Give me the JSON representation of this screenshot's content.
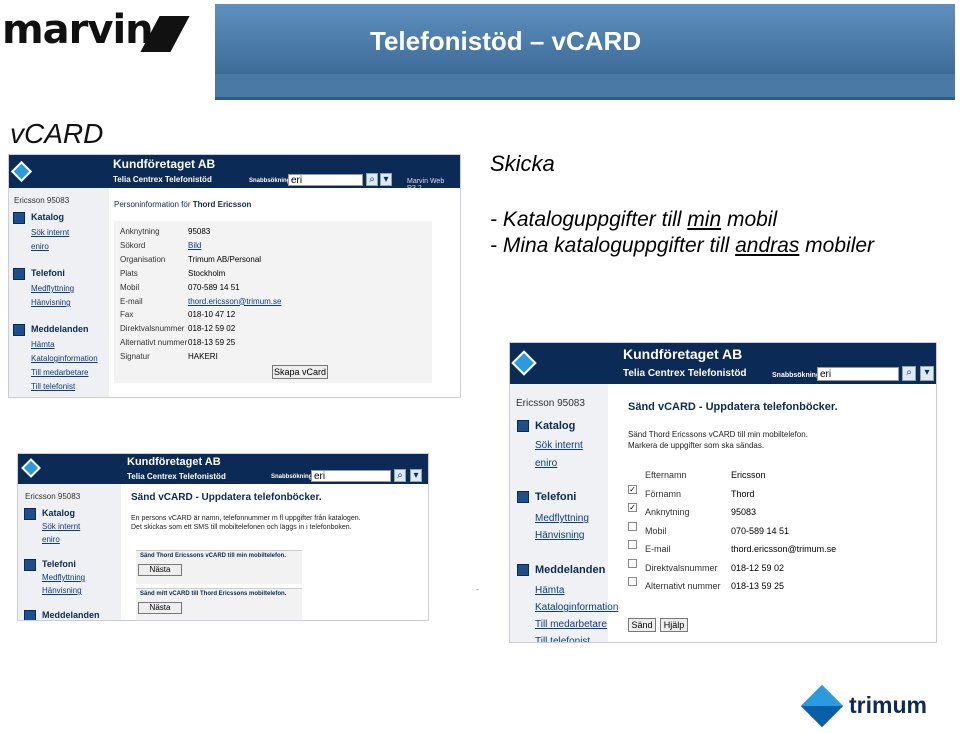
{
  "slide": {
    "logo_text": "marvin",
    "title": "Telefonistöd – vCARD",
    "heading": "vCARD",
    "skicka": "Skicka",
    "bullet1": {
      "pre": "- Kataloguppgifter till ",
      "u": "min",
      "post": " mobil"
    },
    "bullet2": {
      "pre": "- Mina kataloguppgifter till ",
      "u": "andras",
      "post": " mobiler"
    },
    "footer_logo": "trimum"
  },
  "app": {
    "company": "Kundföretaget AB",
    "subtitle": "Telia Centrex Telefonistöd",
    "quick_label": "Snabbsökning",
    "quick_value": "eri",
    "version": "Marvin Web R3.2",
    "user": "Ericsson 95083",
    "sections": {
      "katalog": "Katalog",
      "sok_internt": "Sök internt",
      "eniro": "eniro",
      "telefoni": "Telefoni",
      "medflyttning": "Medflyttning",
      "hanvisning": "Hänvisning",
      "meddelanden": "Meddelanden",
      "hamta": "Hämta",
      "kataloginformation": "Kataloginformation",
      "till_medarbetare": "Till medarbetare",
      "till_telefonist": "Till telefonist"
    }
  },
  "person_info": {
    "heading_prefix": "Personinformation för",
    "name": "Thord Ericsson",
    "rows": [
      {
        "label": "Anknytning",
        "value": "95083"
      },
      {
        "label": "Sökord",
        "value": "Bild"
      },
      {
        "label": "Organisation",
        "value": "Trimum AB/Personal"
      },
      {
        "label": "Plats",
        "value": "Stockholm"
      },
      {
        "label": "Mobil",
        "value": "070-589 14 51"
      },
      {
        "label": "E-mail",
        "value": "thord.ericsson@trimum.se"
      },
      {
        "label": "Fax",
        "value": "018-10 47 12"
      },
      {
        "label": "Direktvalsnummer",
        "value": "018-12 59 02"
      },
      {
        "label": "Alternativt nummer",
        "value": "018-13 59 25"
      },
      {
        "label": "Signatur",
        "value": "HAKERI"
      }
    ],
    "create_button": "Skapa vCard"
  },
  "send_left": {
    "title": "Sänd vCARD - Uppdatera telefonböcker.",
    "desc1": "En persons vCARD är namn, telefonnummer m fl uppgifter från katalogen.",
    "desc2": "Det skickas som ett SMS till mobiltelefonen och läggs in i telefonboken.",
    "box1": "Sänd Thord Ericssons vCARD till min mobiltelefon.",
    "box2": "Sänd mitt vCARD till Thord Ericssons mobiltelefon.",
    "next": "Nästa"
  },
  "send_right": {
    "title": "Sänd vCARD - Uppdatera telefonböcker.",
    "desc1": "Sänd Thord Ericssons vCARD till min mobiltelefon.",
    "desc2": "Markera de uppgifter som ska sändas.",
    "rows": [
      {
        "label": "Efternamn",
        "value": "Ericsson",
        "check": ""
      },
      {
        "label": "Förnamn",
        "value": "Thord",
        "check": "✓"
      },
      {
        "label": "Anknytning",
        "value": "95083",
        "check": "✓"
      },
      {
        "label": "Mobil",
        "value": "070-589 14 51",
        "check": ""
      },
      {
        "label": "E-mail",
        "value": "thord.ericsson@trimum.se",
        "check": ""
      },
      {
        "label": "Direktvalsnummer",
        "value": "018-12 59 02",
        "check": ""
      },
      {
        "label": "Alternativt nummer",
        "value": "018-13 59 25",
        "check": ""
      }
    ],
    "send": "Sänd",
    "help": "Hjälp"
  },
  "colors": {
    "navy": "#0b2a55",
    "accent": "#2b9be0",
    "header_blue": "#4a79a6"
  }
}
